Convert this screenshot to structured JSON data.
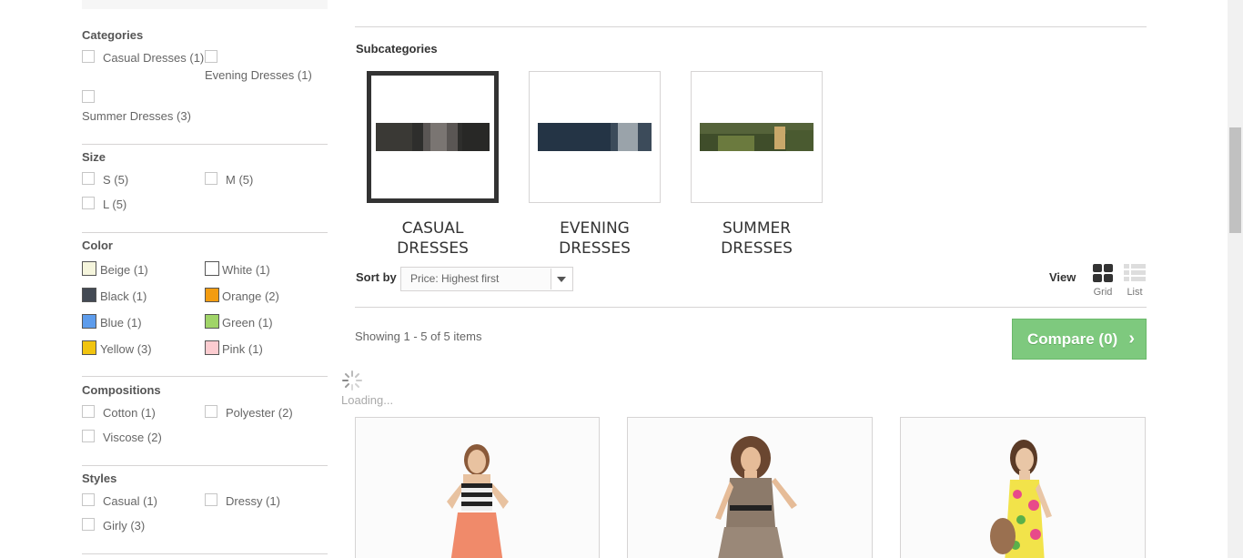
{
  "sidebar": {
    "categories": {
      "title": "Categories",
      "items": [
        "Casual Dresses (1)",
        "Evening Dresses (1)",
        "Summer Dresses (3)"
      ]
    },
    "size": {
      "title": "Size",
      "items": [
        "S (5)",
        "M (5)",
        "L (5)"
      ]
    },
    "color": {
      "title": "Color",
      "items": [
        {
          "label": "Beige (1)",
          "hex": "#f5f5dc"
        },
        {
          "label": "White (1)",
          "hex": "#ffffff"
        },
        {
          "label": "Black (1)",
          "hex": "#434a54"
        },
        {
          "label": "Orange (2)",
          "hex": "#f39c11"
        },
        {
          "label": "Blue (1)",
          "hex": "#5d9cec"
        },
        {
          "label": "Green (1)",
          "hex": "#a0d468"
        },
        {
          "label": "Yellow (3)",
          "hex": "#f1c40f"
        },
        {
          "label": "Pink (1)",
          "hex": "#fcccd0"
        }
      ]
    },
    "compositions": {
      "title": "Compositions",
      "items": [
        "Cotton (1)",
        "Polyester (2)",
        "Viscose (2)"
      ]
    },
    "styles": {
      "title": "Styles",
      "items": [
        "Casual (1)",
        "Dressy (1)",
        "Girly (3)"
      ]
    }
  },
  "subcategories": {
    "title": "Subcategories",
    "items": [
      {
        "name": "Casual Dresses"
      },
      {
        "name": "Evening Dresses"
      },
      {
        "name": "Summer Dresses"
      }
    ]
  },
  "sort": {
    "label": "Sort by",
    "selected": "Price: Highest first"
  },
  "view": {
    "label": "View",
    "grid_label": "Grid",
    "list_label": "List"
  },
  "showing_text": "Showing 1 - 5 of 5 items",
  "compare": {
    "label": "Compare (0)",
    "color": "#7ec97e"
  },
  "loading_text": "Loading..."
}
